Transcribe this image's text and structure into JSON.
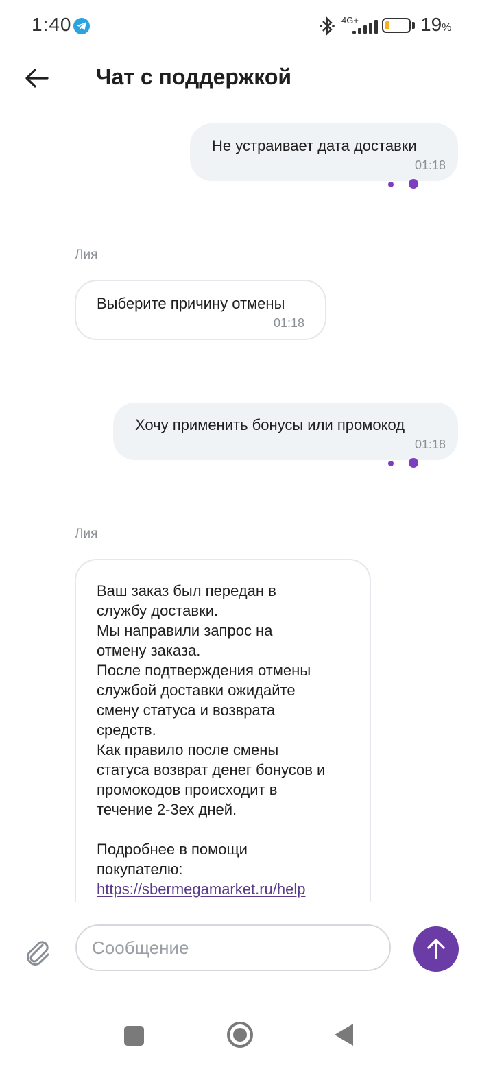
{
  "status_bar": {
    "time": "1:40",
    "network_type": "4G+",
    "battery_percent": 19,
    "battery_text": "19",
    "battery_unit": "%",
    "icons": [
      "telegram-icon",
      "bluetooth-icon",
      "signal-icon",
      "battery-icon"
    ]
  },
  "header": {
    "title": "Чат с поддержкой",
    "back_icon": "arrow-left-icon"
  },
  "messages": [
    {
      "direction": "outgoing",
      "text": "Не устраивает дата доставки",
      "time": "01:18",
      "read": true
    },
    {
      "direction": "incoming",
      "sender": "Лия",
      "text": "Выберите причину отмены",
      "time": "01:18"
    },
    {
      "direction": "outgoing",
      "text": "Хочу применить бонусы или промокод",
      "time": "01:18",
      "read": true
    },
    {
      "direction": "incoming",
      "sender": "Лия",
      "text": "Ваш заказ был передан в\nслужбу доставки.\nМы направили запрос на\nотмену заказа.\nПосле подтверждения отмены\nслужбой доставки ожидайте\nсмену статуса и возврата\nсредств.\nКак правило после смены\nстатуса возврат денег бонусов и\nпромокодов происходит в\nтечение 2-3ех дней.\n\nПодробнее в помощи\nпокупателю:",
      "link": "https://sbermegamarket.ru/help"
    }
  ],
  "composer": {
    "placeholder": "Сообщение",
    "value": "",
    "attach_icon": "paperclip-icon",
    "send_icon": "arrow-up-icon",
    "send_color": "#6b3ba6"
  },
  "nav_bar": {
    "buttons": [
      "recents-square-icon",
      "home-circle-icon",
      "back-triangle-icon"
    ]
  },
  "colors": {
    "outgoing_bubble": "#f0f3f6",
    "incoming_border": "#e4e7eb",
    "accent": "#6b3ba6",
    "battery_fill": "#f5b026"
  }
}
